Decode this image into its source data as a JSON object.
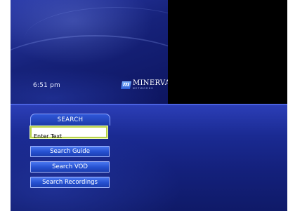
{
  "status": {
    "time": "6:51 pm"
  },
  "brand": {
    "mark": "m",
    "name": "MINERVA",
    "tagline": "NETWORKS"
  },
  "search_menu": {
    "title": "SEARCH",
    "input": {
      "placeholder": "Enter Text",
      "value": ""
    },
    "items": [
      {
        "label": "Search Guide"
      },
      {
        "label": "Search VOD"
      },
      {
        "label": "Search Recordings"
      }
    ]
  }
}
